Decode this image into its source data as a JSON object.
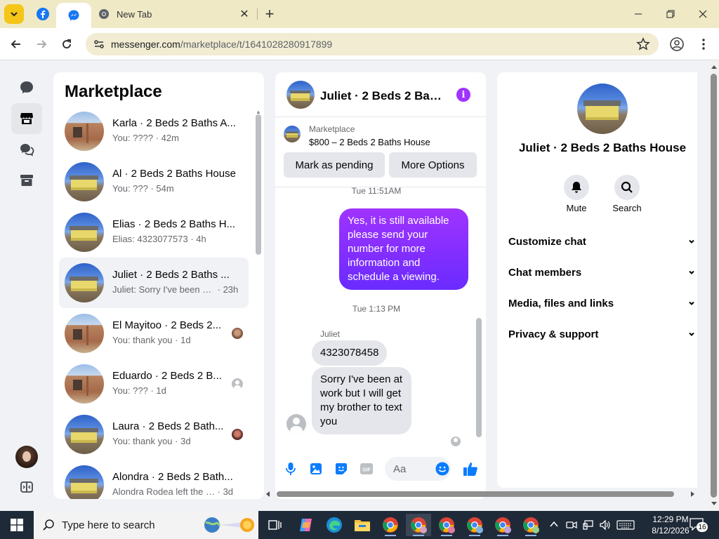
{
  "browser": {
    "tabs": [
      {
        "label": "",
        "icon": "facebook-icon"
      },
      {
        "label": "",
        "icon": "messenger-icon"
      },
      {
        "label": "New Tab",
        "icon": "chrome-icon"
      }
    ],
    "url_host": "messenger.com",
    "url_path": "/marketplace/t/1641028280917899"
  },
  "sidebar": {
    "title": "Marketplace",
    "conversations": [
      {
        "title": "Karla · 2 Beds 2 Baths A...",
        "snippet": "You: ????",
        "time": "· 42m",
        "thumb": "red"
      },
      {
        "title": "Al · 2 Beds 2 Baths House",
        "snippet": "You: ???",
        "time": "· 54m",
        "thumb": "yellow"
      },
      {
        "title": "Elias · 2 Beds 2 Baths H...",
        "snippet": "Elias: 4323077573",
        "time": "· 4h",
        "thumb": "yellow"
      },
      {
        "title": "Juliet · 2 Beds 2 Baths ...",
        "snippet": "Juliet: Sorry I've been at...",
        "time": "· 23h",
        "thumb": "yellow"
      },
      {
        "title": "El Mayitoo · 2 Beds 2...",
        "snippet": "You: thank you",
        "time": "· 1d",
        "thumb": "red"
      },
      {
        "title": "Eduardo · 2 Beds 2 B...",
        "snippet": "You: ???",
        "time": "· 1d",
        "thumb": "red"
      },
      {
        "title": "Laura · 2 Beds 2 Bath...",
        "snippet": "You: thank you",
        "time": "· 3d",
        "thumb": "yellow"
      },
      {
        "title": "Alondra · 2 Beds 2 Bath...",
        "snippet": "Alondra Rodea left the g...",
        "time": "· 3d",
        "thumb": "yellow"
      }
    ]
  },
  "chat": {
    "title": "Juliet · 2 Beds 2 Bath...",
    "listing_source": "Marketplace",
    "listing_price": "$800 – 2 Beds 2 Baths House",
    "mark_pending_label": "Mark as pending",
    "more_options_label": "More Options",
    "timestamp_1": "Tue 11:51AM",
    "outgoing_message": "Yes, it is still available please send your number for more information and schedule a viewing.",
    "timestamp_2": "Tue 1:13 PM",
    "sender_name": "Juliet",
    "incoming_1": "4323078458",
    "incoming_2": "Sorry I've been at work but I will get my brother to text you",
    "input_placeholder": "Aa",
    "accent_color": "#a033ff",
    "like_color": "#0a7cff"
  },
  "details": {
    "title": "Juliet · 2 Beds 2 Baths House",
    "mute_label": "Mute",
    "search_label": "Search",
    "sections": [
      "Customize chat",
      "Chat members",
      "Media, files and links",
      "Privacy & support"
    ]
  },
  "taskbar": {
    "search_placeholder": "Type here to search",
    "time": "12:29 PM",
    "date": "8/12/2026",
    "notification_count": "16"
  }
}
